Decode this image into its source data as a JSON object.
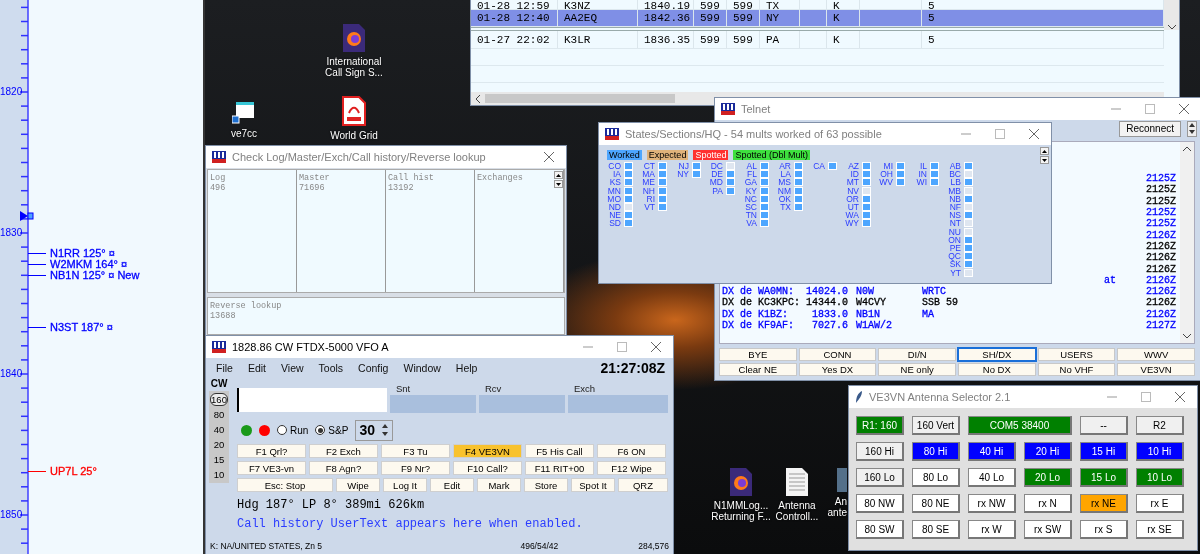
{
  "bandmap": {
    "scale_labels": [
      "1820",
      "1830",
      "1840",
      "1850"
    ],
    "spots": [
      {
        "text": "N1RR 125° ¤",
        "color": "#0000ff"
      },
      {
        "text": "W2MKM 164° ¤",
        "color": "#0000ff"
      },
      {
        "text": "NB1N 125° ¤ New",
        "color": "#0000ff"
      },
      {
        "text": "N3ST 187° ¤",
        "color": "#0000ff"
      },
      {
        "text": "UP7L 25°",
        "color": "#ff0000"
      }
    ]
  },
  "desktop_icons": [
    {
      "label": "International Call Sign S...",
      "kind": "firefox"
    },
    {
      "label": "ve7cc",
      "kind": "shortcut"
    },
    {
      "label": "World Grid",
      "kind": "pdf"
    },
    {
      "label": "N1MMLog... Returning F...",
      "kind": "firefox"
    },
    {
      "label": "Antenna Controll...",
      "kind": "text"
    },
    {
      "label": "An ante",
      "kind": "app"
    }
  ],
  "log": {
    "rows": [
      {
        "cells": [
          "01-28 12:59",
          "K3NZ",
          "1840.19",
          "599",
          "599",
          "TX",
          "K",
          "5"
        ],
        "selected": false
      },
      {
        "cells": [
          "01-28 12:40",
          "AA2EQ",
          "1842.36",
          "599",
          "599",
          "NY",
          "K",
          "5"
        ],
        "selected": true
      },
      {
        "cells": [
          "01-27 22:02",
          "K3LR",
          "1836.35",
          "599",
          "599",
          "PA",
          "K",
          "5"
        ],
        "selected": false
      }
    ]
  },
  "telnet": {
    "title": "Telnet",
    "reconnect": "Reconnect",
    "lines": [
      {
        "time": "2125Z",
        "color": "#0000ff"
      },
      {
        "time": "2125Z",
        "color": "#000000"
      },
      {
        "time": "2125Z",
        "color": "#000000"
      },
      {
        "time": "2125Z",
        "color": "#0000ff"
      },
      {
        "time": "2125Z",
        "color": "#0000ff"
      },
      {
        "time": "2126Z",
        "color": "#0000ff"
      },
      {
        "time": "2126Z",
        "color": "#000000"
      },
      {
        "time": "2126Z",
        "color": "#000000"
      },
      {
        "time": "2126Z",
        "color": "#000000"
      },
      {
        "tail": "at",
        "time": "2126Z",
        "color": "#0000ff"
      },
      {
        "spotter": "DX de WA0MN:",
        "freq": "14024.0",
        "call": "N0W",
        "comment": "WRTC",
        "time": "2126Z",
        "color": "#0000ff"
      },
      {
        "spotter": "DX de KC3KPC:",
        "freq": "14344.0",
        "call": "W4CVY",
        "comment": "SSB 59",
        "time": "2126Z",
        "color": "#000000"
      },
      {
        "spotter": "DX de K1BZ:",
        "freq": "1833.0",
        "call": "NB1N",
        "comment": "MA",
        "time": "2126Z",
        "color": "#0000ff"
      },
      {
        "spotter": "DX de KF9AF:",
        "freq": "7027.6",
        "call": "W1AW/2",
        "time": "2127Z",
        "color": "#0000ff"
      }
    ],
    "buttons": [
      {
        "label": "BYE",
        "selected": false
      },
      {
        "label": "CONN",
        "selected": false
      },
      {
        "label": "DI/N",
        "selected": false
      },
      {
        "label": "SH/DX",
        "selected": true
      },
      {
        "label": "USERS",
        "selected": false
      },
      {
        "label": "WWV",
        "selected": false
      },
      {
        "label": "Clear NE",
        "selected": false
      },
      {
        "label": "Yes DX",
        "selected": false
      },
      {
        "label": "NE only",
        "selected": false
      },
      {
        "label": "No DX",
        "selected": false
      },
      {
        "label": "No VHF",
        "selected": false
      },
      {
        "label": "VE3VN",
        "selected": false
      }
    ]
  },
  "states": {
    "title": "States/Sections/HQ - 54 mults worked of 63 possible",
    "legend": [
      {
        "label": "Worked",
        "color": "#4da6ff"
      },
      {
        "label": "Expected",
        "color": "#e0b27a"
      },
      {
        "label": "Spotted",
        "color": "#ff3030"
      },
      {
        "label": "Spotted (Dbl Mult)",
        "color": "#3ee03e"
      }
    ],
    "columns": [
      [
        {
          "label": "CO",
          "worked": true
        },
        {
          "label": "IA",
          "worked": true
        },
        {
          "label": "KS",
          "worked": true
        },
        {
          "label": "MN",
          "worked": true
        },
        {
          "label": "MO",
          "worked": true
        },
        {
          "label": "ND",
          "worked": false
        },
        {
          "label": "NE",
          "worked": true
        },
        {
          "label": "SD",
          "worked": true
        }
      ],
      [
        {
          "label": "CT",
          "worked": true
        },
        {
          "label": "MA",
          "worked": true
        },
        {
          "label": "ME",
          "worked": true
        },
        {
          "label": "NH",
          "worked": true
        },
        {
          "label": "RI",
          "worked": true
        },
        {
          "label": "VT",
          "worked": true
        }
      ],
      [
        {
          "label": "NJ",
          "worked": true
        },
        {
          "label": "NY",
          "worked": true
        }
      ],
      [
        {
          "label": "DC",
          "worked": false
        },
        {
          "label": "DE",
          "worked": true
        },
        {
          "label": "MD",
          "worked": true
        },
        {
          "label": "PA",
          "worked": true
        }
      ],
      [
        {
          "label": "AL",
          "worked": true
        },
        {
          "label": "FL",
          "worked": true
        },
        {
          "label": "GA",
          "worked": true
        },
        {
          "label": "KY",
          "worked": true
        },
        {
          "label": "NC",
          "worked": true
        },
        {
          "label": "SC",
          "worked": true
        },
        {
          "label": "TN",
          "worked": true
        },
        {
          "label": "VA",
          "worked": true
        }
      ],
      [
        {
          "label": "AR",
          "worked": true
        },
        {
          "label": "LA",
          "worked": true
        },
        {
          "label": "MS",
          "worked": true
        },
        {
          "label": "NM",
          "worked": true
        },
        {
          "label": "OK",
          "worked": true
        },
        {
          "label": "TX",
          "worked": true
        }
      ],
      [
        {
          "label": "CA",
          "worked": true
        }
      ],
      [
        {
          "label": "AZ",
          "worked": true
        },
        {
          "label": "ID",
          "worked": true
        },
        {
          "label": "MT",
          "worked": true
        },
        {
          "label": "NV",
          "worked": false
        },
        {
          "label": "OR",
          "worked": true
        },
        {
          "label": "UT",
          "worked": true
        },
        {
          "label": "WA",
          "worked": true
        },
        {
          "label": "WY",
          "worked": true
        }
      ],
      [
        {
          "label": "MI",
          "worked": true
        },
        {
          "label": "OH",
          "worked": true
        },
        {
          "label": "WV",
          "worked": true
        }
      ],
      [
        {
          "label": "IL",
          "worked": true
        },
        {
          "label": "IN",
          "worked": true
        },
        {
          "label": "WI",
          "worked": true
        }
      ],
      [
        {
          "label": "AB",
          "worked": true
        },
        {
          "label": "BC",
          "worked": false
        },
        {
          "label": "LB",
          "worked": true
        },
        {
          "label": "MB",
          "worked": false
        },
        {
          "label": "NB",
          "worked": true
        },
        {
          "label": "NF",
          "worked": false
        },
        {
          "label": "NS",
          "worked": true
        },
        {
          "label": "NT",
          "worked": false
        },
        {
          "label": "NU",
          "worked": false
        },
        {
          "label": "ON",
          "worked": true
        },
        {
          "label": "PE",
          "worked": true
        },
        {
          "label": "QC",
          "worked": true
        },
        {
          "label": "SK",
          "worked": true
        },
        {
          "label": "YT",
          "worked": false
        }
      ]
    ]
  },
  "check_log": {
    "title": "Check Log/Master/Exch/Call history/Reverse lookup",
    "panes": [
      {
        "heading": "Log",
        "value": "496"
      },
      {
        "heading": "Master",
        "value": "71696"
      },
      {
        "heading": "Call hist",
        "value": "13192"
      },
      {
        "heading": "Exchanges"
      }
    ],
    "reverse": {
      "heading": "Reverse lookup",
      "value": "13688"
    }
  },
  "entry": {
    "title": "1828.86 CW FTDX-5000 VFO A",
    "menu": [
      "File",
      "Edit",
      "View",
      "Tools",
      "Config",
      "Window",
      "Help"
    ],
    "clock": "21:27:08Z",
    "mode": "CW",
    "bands": [
      {
        "label": "160",
        "selected": true
      },
      {
        "label": "80",
        "selected": false
      },
      {
        "label": "40",
        "selected": false
      },
      {
        "label": "20",
        "selected": false
      },
      {
        "label": "15",
        "selected": false
      },
      {
        "label": "10",
        "selected": false
      }
    ],
    "fields": [
      "Snt",
      "Rcv",
      "Exch"
    ],
    "radios": [
      {
        "label": "Run",
        "selected": false
      },
      {
        "label": "S&P",
        "selected": true
      }
    ],
    "spinner": "30",
    "fkeys": [
      {
        "label": "F1 Qrl?",
        "highlighted": false
      },
      {
        "label": "F2 Exch",
        "highlighted": false
      },
      {
        "label": "F3 Tu",
        "highlighted": false
      },
      {
        "label": "F4 VE3VN",
        "highlighted": true
      },
      {
        "label": "F5 His Call",
        "highlighted": false
      },
      {
        "label": "F6 ON",
        "highlighted": false
      },
      {
        "label": "F7 VE3-vn",
        "highlighted": false
      },
      {
        "label": "F8 Agn?",
        "highlighted": false
      },
      {
        "label": "F9 Nr?",
        "highlighted": false
      },
      {
        "label": "F10 Call?",
        "highlighted": false
      },
      {
        "label": "F11 RIT+00",
        "highlighted": false
      },
      {
        "label": "F12 Wipe",
        "highlighted": false
      }
    ],
    "actions": [
      "Esc: Stop",
      "Wipe",
      "Log It",
      "Edit",
      "Mark",
      "Store",
      "Spot It",
      "QRZ"
    ],
    "heading_line": "Hdg 187° LP 8° 389mi 626km",
    "user_text": "Call history UserText appears here when enabled.",
    "status": [
      "K: NA/UNITED STATES, Zn 5",
      "496/54/42",
      "284,576"
    ]
  },
  "antenna": {
    "title": "VE3VN Antenna Selector 2.1",
    "buttons": [
      {
        "label": "R1: 160",
        "color": "#008000"
      },
      {
        "label": "160 Vert",
        "color": "#f0f0f0"
      },
      {
        "label": "COM5 38400",
        "color": "#008000",
        "kind": "wide"
      },
      {
        "label": "--",
        "color": "#f0f0f0"
      },
      {
        "label": "R2",
        "color": "#f0f0f0"
      },
      {
        "label": "160 Hi",
        "color": "#f0f0f0"
      },
      {
        "label": "80 Hi",
        "color": "#0000ff"
      },
      {
        "label": "40 Hi",
        "color": "#0000ff"
      },
      {
        "label": "20 Hi",
        "color": "#0000ff"
      },
      {
        "label": "15 Hi",
        "color": "#0000ff"
      },
      {
        "label": "10 Hi",
        "color": "#0000ff"
      },
      {
        "label": "160 Lo",
        "color": "#f0f0f0"
      },
      {
        "label": "80 Lo",
        "color": "#ffffff"
      },
      {
        "label": "40 Lo",
        "color": "#ffffff"
      },
      {
        "label": "20 Lo",
        "color": "#008000"
      },
      {
        "label": "15 Lo",
        "color": "#008000"
      },
      {
        "label": "10 Lo",
        "color": "#008000"
      },
      {
        "label": "80 NW",
        "color": "#ffffff"
      },
      {
        "label": "80 NE",
        "color": "#ffffff"
      },
      {
        "label": "rx NW",
        "color": "#ffffff"
      },
      {
        "label": "rx N",
        "color": "#ffffff"
      },
      {
        "label": "rx NE",
        "color": "#ffa500"
      },
      {
        "label": "rx E",
        "color": "#ffffff"
      },
      {
        "label": "80 SW",
        "color": "#ffffff"
      },
      {
        "label": "80 SE",
        "color": "#ffffff"
      },
      {
        "label": "rx W",
        "color": "#ffffff"
      },
      {
        "label": "rx SW",
        "color": "#ffffff"
      },
      {
        "label": "rx S",
        "color": "#ffffff"
      },
      {
        "label": "rx SE",
        "color": "#ffffff"
      }
    ]
  }
}
